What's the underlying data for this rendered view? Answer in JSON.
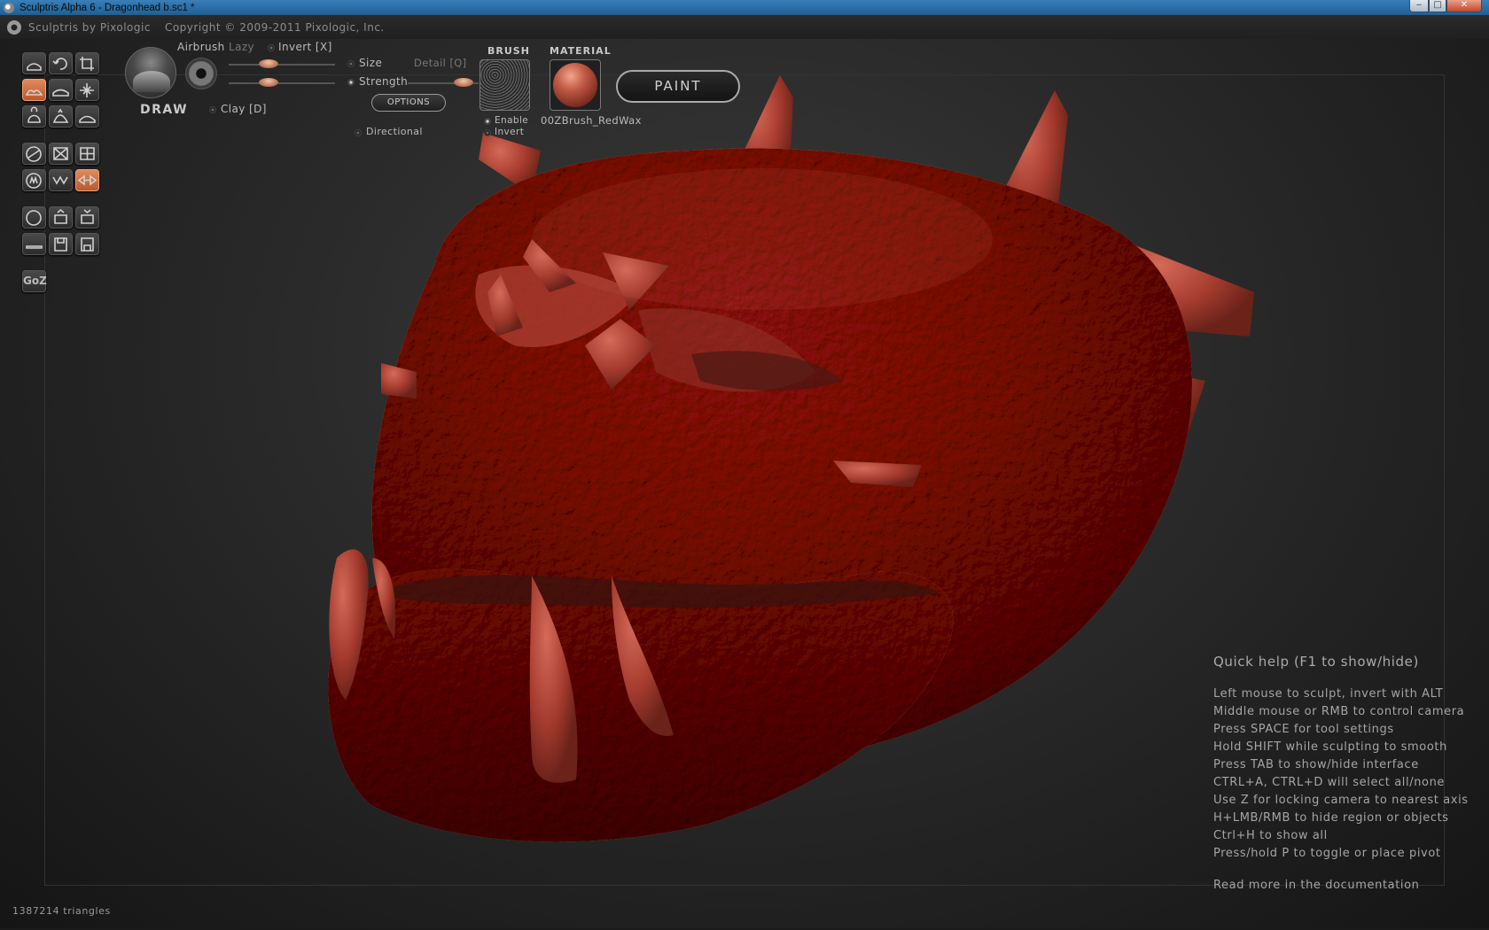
{
  "window": {
    "title": "Sculptris Alpha 6 - Dragonhead b.sc1 *",
    "minimize_glyph": "‒",
    "maximize_glyph": "□",
    "close_glyph": "✕"
  },
  "header": {
    "app_name": "Sculptris by Pixologic",
    "copyright": "Copyright © 2009-2011 Pixologic, Inc."
  },
  "tools": {
    "rows": [
      [
        "crease-icon",
        "rotate-icon",
        "crop-icon"
      ],
      [
        "draw-icon",
        "flatten-icon",
        "pinch-icon"
      ],
      [
        "inflate-icon",
        "grab-icon",
        "smooth-icon"
      ],
      [
        "reduce-brush-icon",
        "reduce-selection-icon",
        "subdivide-icon"
      ],
      [
        "mask-icon",
        "wave-icon",
        "symmetry-icon"
      ],
      [
        "sphere-icon",
        "import-obj-icon",
        "export-obj-icon"
      ],
      [
        "plane-icon",
        "save-icon",
        "save-as-icon"
      ]
    ],
    "active": [
      "draw-icon",
      "symmetry-icon"
    ],
    "goz_label": "GoZ"
  },
  "brush_panel": {
    "tool_name": "DRAW",
    "airbrush": "Airbrush",
    "lazy": "Lazy",
    "invert": "Invert [X]",
    "size": "Size",
    "strength": "Strength",
    "detail": "Detail [Q]",
    "clay": "Clay [D]",
    "options": "OPTIONS",
    "directional": "Directional",
    "size_value": 0.35,
    "strength_value": 0.35,
    "detail_value": 0.9
  },
  "brush": {
    "header": "BRUSH",
    "enable": "Enable",
    "invert": "Invert"
  },
  "material": {
    "header": "MATERIAL",
    "name": "00ZBrush_RedWax"
  },
  "paint_label": "PAINT",
  "quick_help": {
    "title": "Quick help (F1 to show/hide)",
    "lines": [
      "Left mouse to sculpt, invert with ALT",
      "Middle mouse or RMB to control camera",
      "Press SPACE for tool settings",
      "Hold SHIFT while sculpting to smooth",
      "Press TAB to show/hide interface",
      "CTRL+A, CTRL+D will select all/none",
      "Use Z for locking camera to nearest axis",
      "H+LMB/RMB to hide region or objects",
      "Ctrl+H to show all",
      "Press/hold P to toggle or place pivot"
    ],
    "more": "Read more in the documentation"
  },
  "status": {
    "triangles": "1387214 triangles"
  },
  "colors": {
    "accent": "#d8733f",
    "model": "#a43b2e"
  }
}
